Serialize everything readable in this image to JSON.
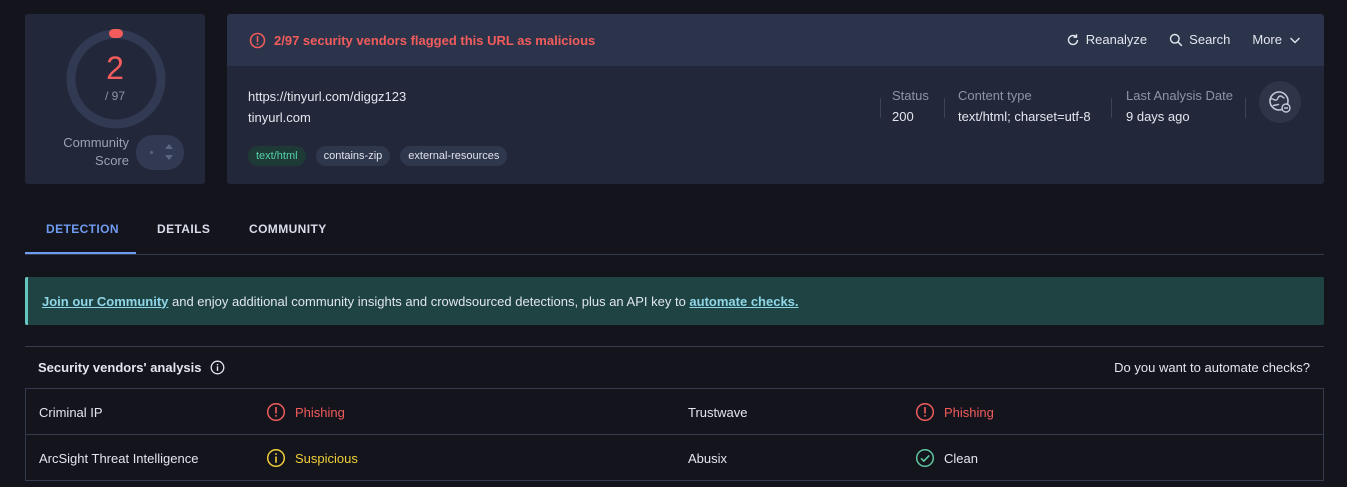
{
  "score": {
    "detections": "2",
    "total": "/ 97",
    "community_label_line1": "Community",
    "community_label_line2": "Score"
  },
  "alert": {
    "text": "2/97 security vendors flagged this URL as malicious"
  },
  "actions": {
    "reanalyze": "Reanalyze",
    "search": "Search",
    "more": "More"
  },
  "target": {
    "url": "https://tinyurl.com/diggz123",
    "domain": "tinyurl.com",
    "tags": [
      "text/html",
      "contains-zip",
      "external-resources"
    ]
  },
  "meta": {
    "status_label": "Status",
    "status_value": "200",
    "content_type_label": "Content type",
    "content_type_value": "text/html; charset=utf-8",
    "last_analysis_label": "Last Analysis Date",
    "last_analysis_value": "9 days ago"
  },
  "tabs": [
    "DETECTION",
    "DETAILS",
    "COMMUNITY"
  ],
  "banner": {
    "link1": "Join our Community",
    "middle": " and enjoy additional community insights and crowdsourced detections, plus an API key to ",
    "link2": "automate checks."
  },
  "vendors": {
    "title": "Security vendors' analysis",
    "cta": "Do you want to automate checks?",
    "rows": [
      {
        "left_name": "Criminal IP",
        "left_result": "Phishing",
        "right_name": "Trustwave",
        "right_result": "Phishing"
      },
      {
        "left_name": "ArcSight Threat Intelligence",
        "left_result": "Suspicious",
        "right_name": "Abusix",
        "right_result": "Clean"
      }
    ]
  },
  "colors": {
    "malicious": "#f25c5c",
    "suspicious": "#f0cf3a",
    "clean": "#5fc7a0",
    "accent": "#6f9bf2",
    "background": "#14141c",
    "card": "#22283a"
  }
}
